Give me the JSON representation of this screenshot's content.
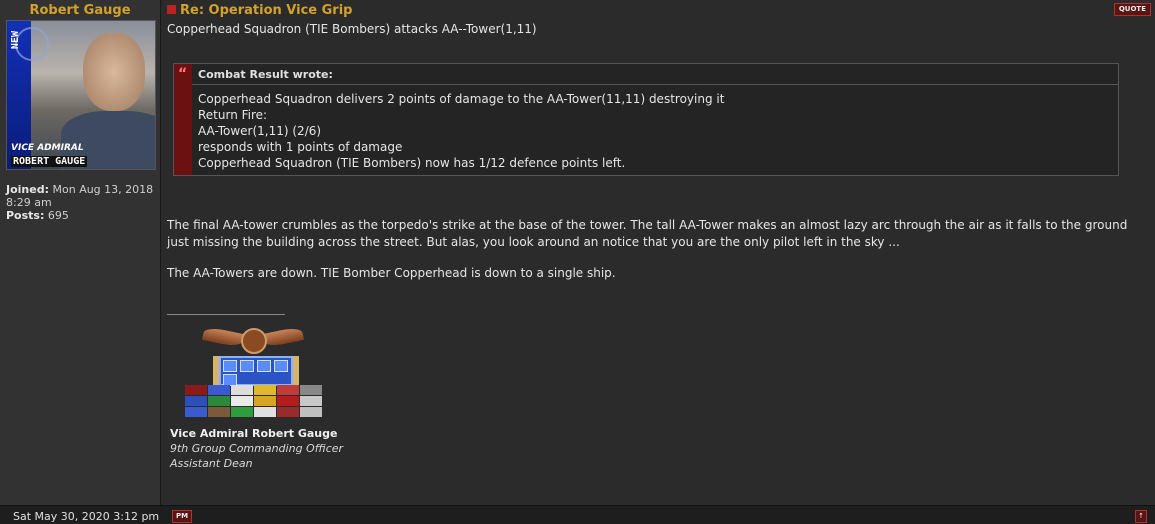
{
  "profile": {
    "username": "Robert Gauge",
    "avatar_rank_text": "VICE ADMIRAL",
    "avatar_name_text": "ROBERT GAUGE",
    "avatar_strip_text": "NEW",
    "joined_label": "Joined:",
    "joined_value": "Mon Aug 13, 2018 8:29 am",
    "posts_label": "Posts:",
    "posts_value": "695"
  },
  "post": {
    "subject": "Re: Operation Vice Grip",
    "quote_button": "QUOTE",
    "first_line": "Copperhead Squadron (TIE Bombers) attacks AA--Tower(1,11)",
    "quote": {
      "header": "Combat Result wrote:",
      "lines": [
        "Copperhead Squadron delivers 2 points of damage to the AA-Tower(11,11) destroying it",
        "Return Fire:",
        "AA-Tower(1,11) (2/6)",
        "responds with 1 points of damage",
        "Copperhead Squadron (TIE Bombers) now has 1/12 defence points left."
      ]
    },
    "paragraph1": "The final AA-tower crumbles as the torpedo's strike at the base of the tower. The tall AA-Tower makes an almost lazy arc through the air as it falls to the ground just missing the building across the street. But alas, you look around an notice that you are the only pilot left in the sky ...",
    "paragraph2": "The AA-Towers are down. TIE Bomber Copperhead is down to a single ship."
  },
  "signature": {
    "name": "Vice Admiral Robert Gauge",
    "line1": "9th Group Commanding Officer",
    "line2": "Assistant Dean"
  },
  "footer": {
    "date": "Sat May 30, 2020 3:12 pm",
    "pm_button": "PM",
    "top_button": "↑"
  },
  "colors": {
    "accent": "#d4a12a",
    "button_bg": "#5a1414",
    "button_border": "#aa3333",
    "quote_bar": "#6b1111"
  }
}
